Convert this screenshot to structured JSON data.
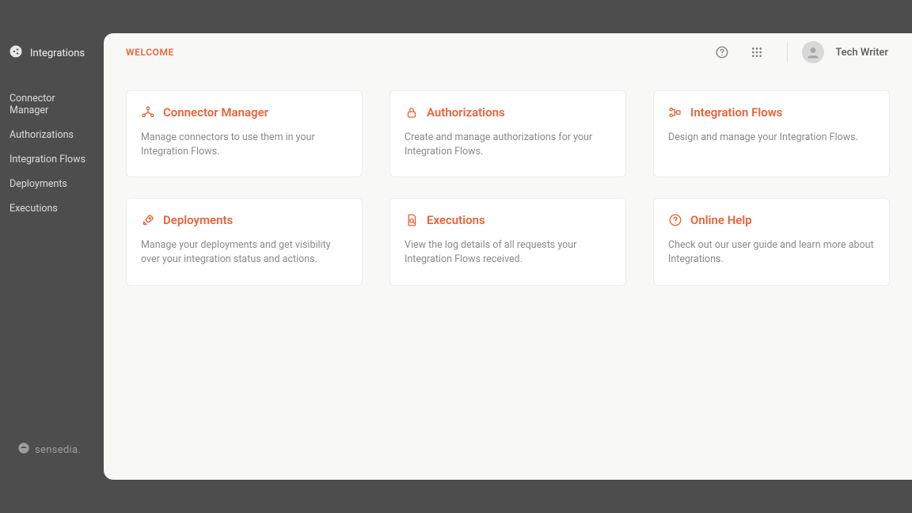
{
  "brand": {
    "name": "Integrations"
  },
  "sidebar": {
    "items": [
      {
        "label": "Connector Manager"
      },
      {
        "label": "Authorizations"
      },
      {
        "label": "Integration Flows"
      },
      {
        "label": "Deployments"
      },
      {
        "label": "Executions"
      }
    ]
  },
  "footer": {
    "label": "sensedia."
  },
  "header": {
    "title": "WELCOME",
    "user_name": "Tech Writer"
  },
  "cards": [
    {
      "title": "Connector Manager",
      "desc": "Manage connectors to use them in your Integration Flows."
    },
    {
      "title": "Authorizations",
      "desc": "Create and manage authorizations for your Integration Flows."
    },
    {
      "title": "Integration Flows",
      "desc": "Design and manage your Integration Flows."
    },
    {
      "title": "Deployments",
      "desc": "Manage your deployments and get visibility over your integration status and actions."
    },
    {
      "title": "Executions",
      "desc": "View the log details of all requests your Integration Flows received."
    },
    {
      "title": "Online Help",
      "desc": "Check out our user guide and learn more about Integrations."
    }
  ]
}
